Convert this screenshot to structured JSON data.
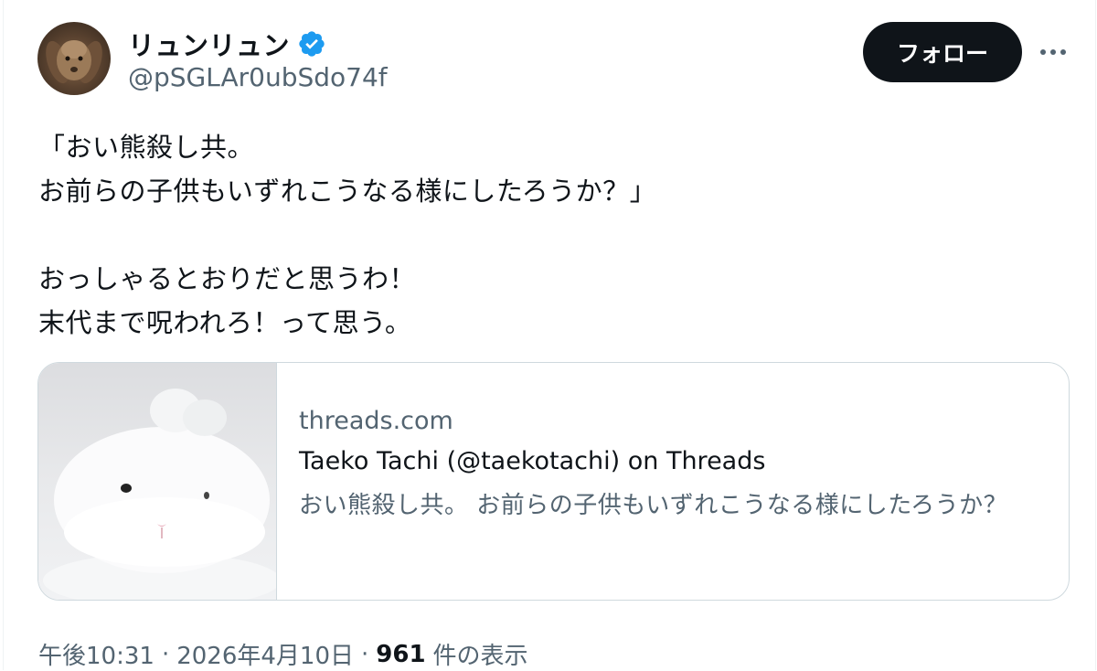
{
  "author": {
    "display_name": "リュンリュン",
    "handle": "@pSGLAr0ubSdo74f",
    "verified_icon": "verified-badge-icon",
    "verified_color": "#1d9bf0"
  },
  "follow_button_label": "フォロー",
  "more_icon": "more-horizontal-icon",
  "tweet_text": "「おい熊殺し共。\nお前らの子供もいずれこうなる様にしたろうか？」\n\nおっしゃるとおりだと思うわ！\n末代まで呪われろ！って思う。",
  "link_card": {
    "domain": "threads.com",
    "title": "Taeko Tachi (@taekotachi) on Threads",
    "description": "おい熊殺し共。 お前らの子供もいずれこうなる様にしたろうか？"
  },
  "meta": {
    "time": "午後10:31",
    "separator": "·",
    "date": "2026年4月10日",
    "views_count": "961",
    "views_label": "件の表示"
  },
  "colors": {
    "text_primary": "#0f1419",
    "text_secondary": "#536471",
    "border": "#cfd9de",
    "button_bg": "#0f1419"
  }
}
